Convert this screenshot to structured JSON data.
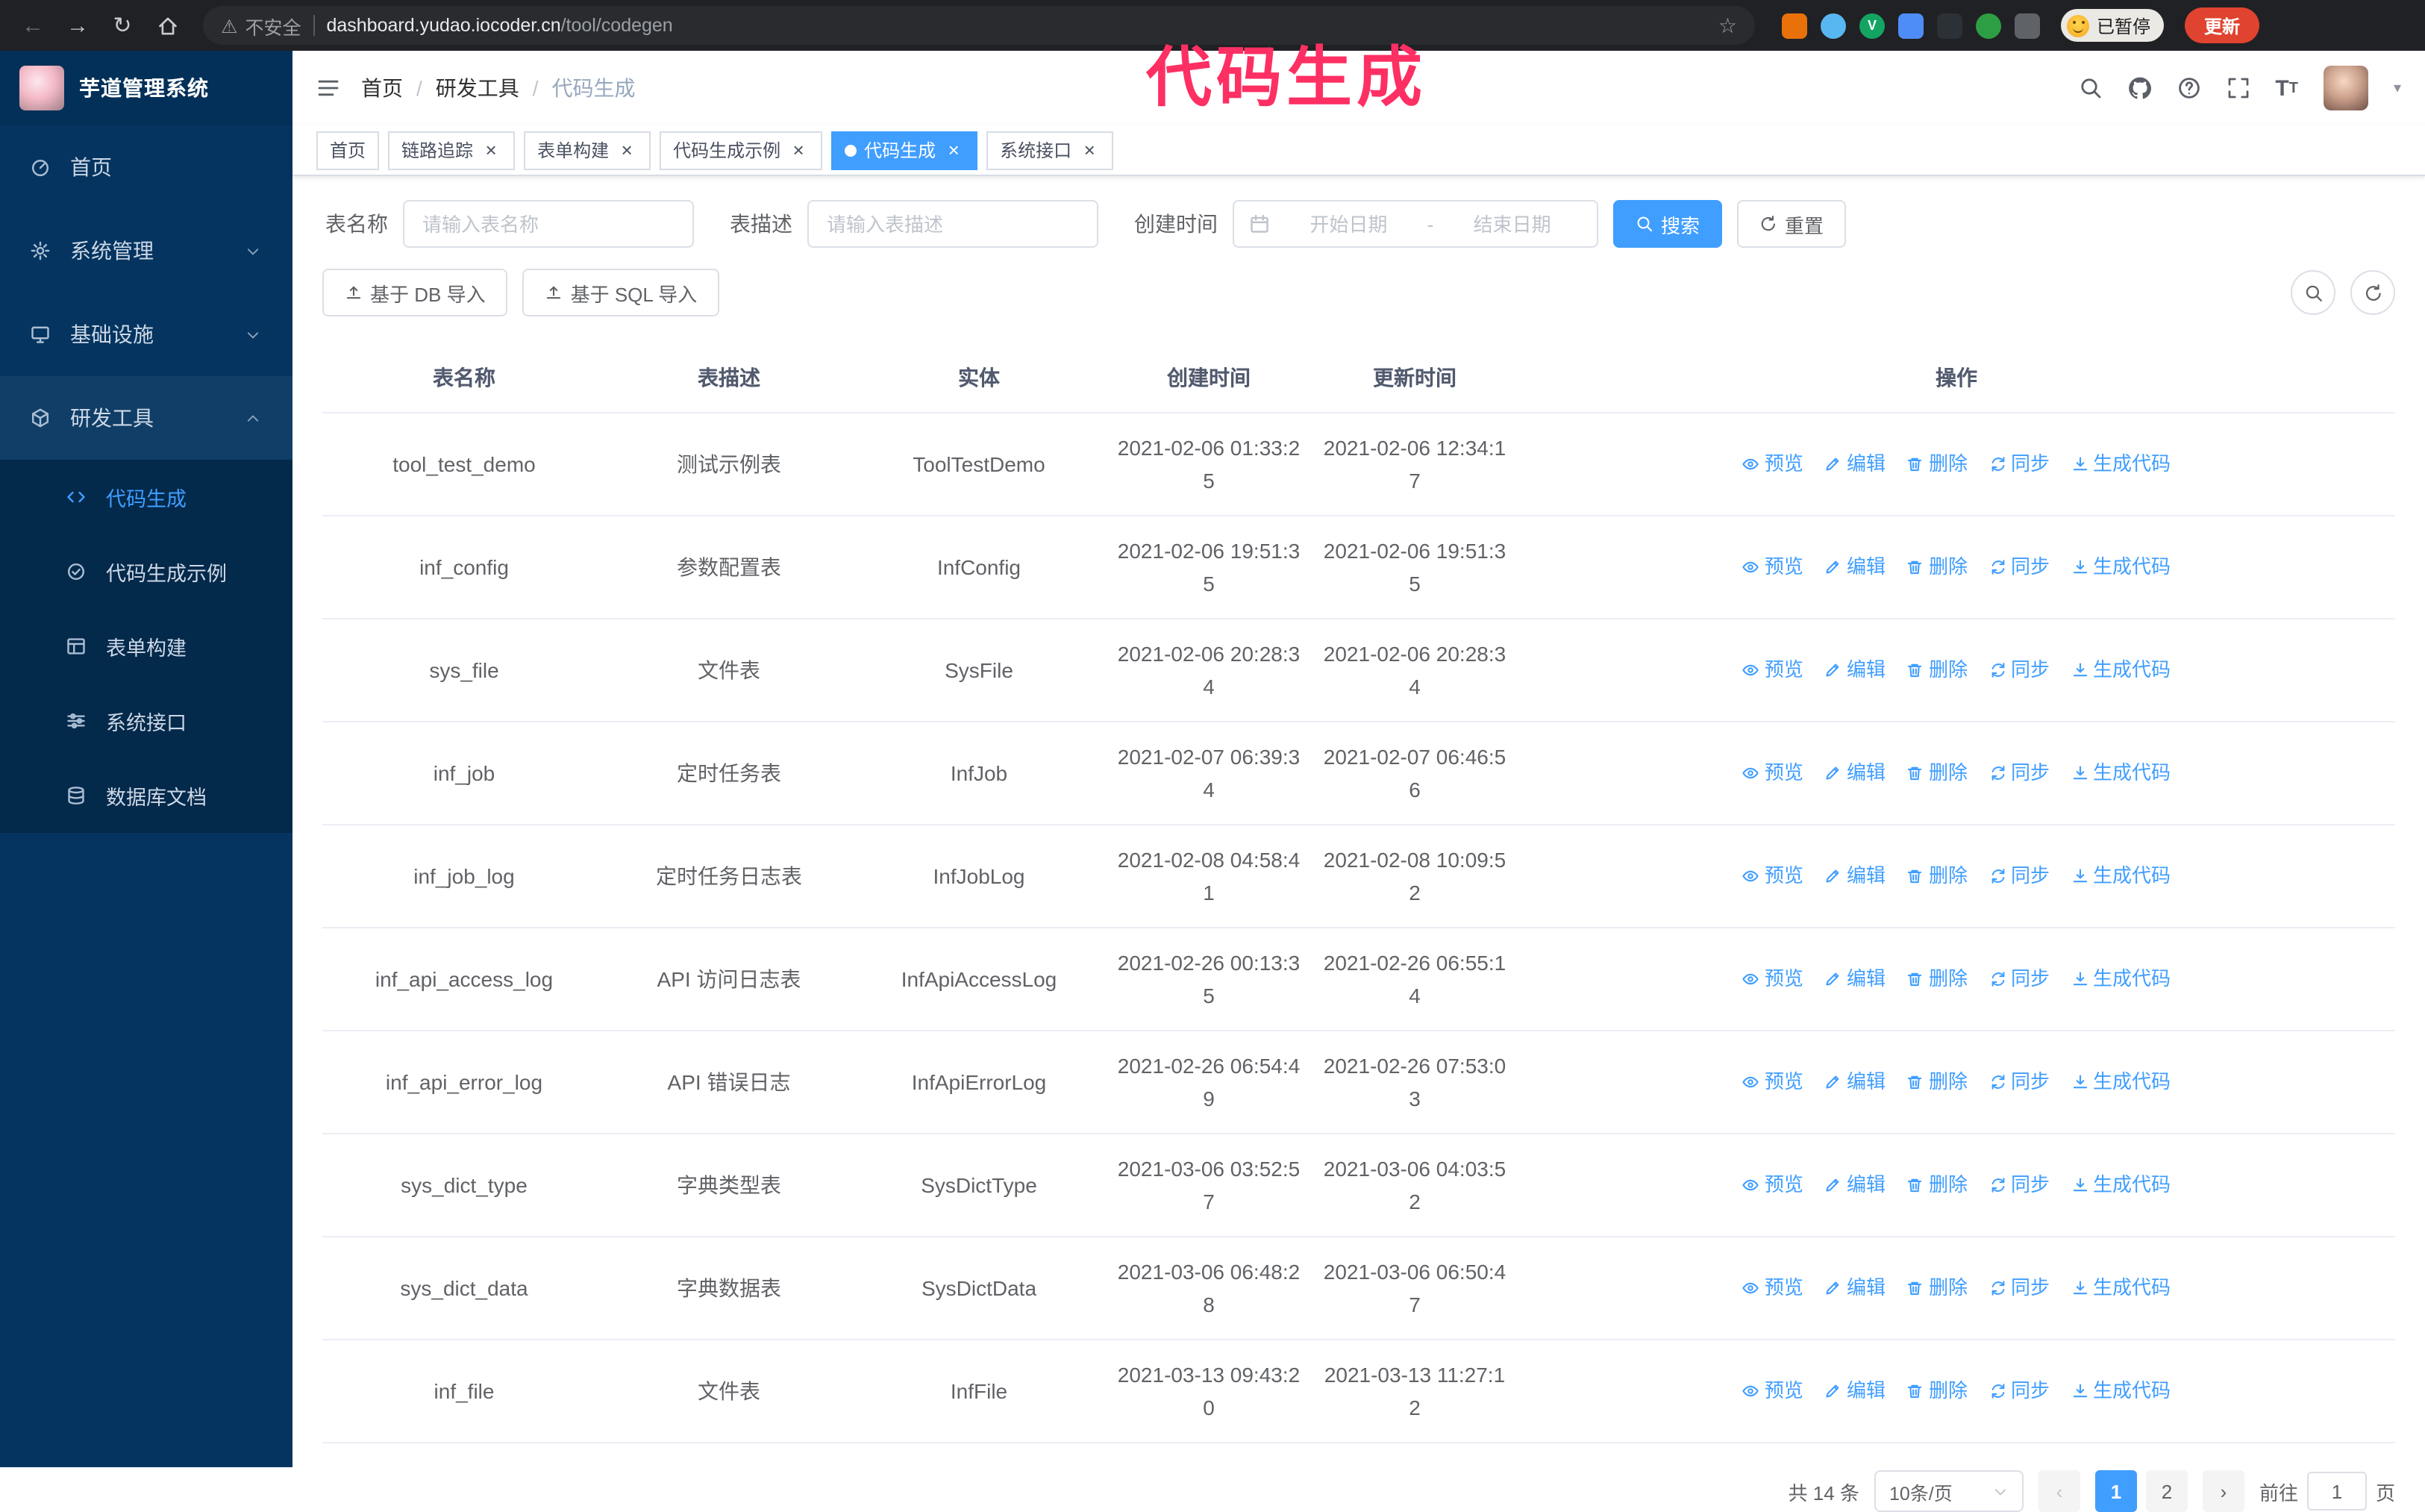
{
  "browser": {
    "warning": "不安全",
    "url_host": "dashboard.yudao.iocoder.cn",
    "url_path": "/tool/codegen",
    "paused_badge": "已暂停",
    "update_button": "更新"
  },
  "annotation": {
    "text": "代码生成"
  },
  "sidebar": {
    "title": "芋道管理系统",
    "menu": [
      {
        "key": "home",
        "label": "首页",
        "icon": "dashboard-icon",
        "type": "item"
      },
      {
        "key": "system",
        "label": "系统管理",
        "icon": "gear-icon",
        "type": "group",
        "state": "collapsed"
      },
      {
        "key": "infra",
        "label": "基础设施",
        "icon": "infra-icon",
        "type": "group",
        "state": "collapsed"
      },
      {
        "key": "dev-tools",
        "label": "研发工具",
        "icon": "tools-icon",
        "type": "group",
        "state": "expanded",
        "children": [
          {
            "key": "codegen",
            "label": "代码生成",
            "icon": "code-icon",
            "active": true
          },
          {
            "key": "codegen-example",
            "label": "代码生成示例",
            "icon": "example-icon",
            "active": false
          },
          {
            "key": "form-builder",
            "label": "表单构建",
            "icon": "form-icon",
            "active": false
          },
          {
            "key": "system-api",
            "label": "系统接口",
            "icon": "api-icon",
            "active": false
          },
          {
            "key": "db-doc",
            "label": "数据库文档",
            "icon": "db-icon",
            "active": false
          }
        ]
      }
    ]
  },
  "navbar": {
    "breadcrumb": [
      "首页",
      "研发工具",
      "代码生成"
    ]
  },
  "tabs": [
    {
      "key": "home",
      "label": "首页",
      "closable": false,
      "active": false
    },
    {
      "key": "tracing",
      "label": "链路追踪",
      "closable": true,
      "active": false
    },
    {
      "key": "form-builder",
      "label": "表单构建",
      "closable": true,
      "active": false
    },
    {
      "key": "codegen-example",
      "label": "代码生成示例",
      "closable": true,
      "active": false
    },
    {
      "key": "codegen",
      "label": "代码生成",
      "closable": true,
      "active": true
    },
    {
      "key": "system-api",
      "label": "系统接口",
      "closable": true,
      "active": false
    }
  ],
  "filters": {
    "name_label": "表名称",
    "name_placeholder": "请输入表名称",
    "desc_label": "表描述",
    "desc_placeholder": "请输入表描述",
    "time_label": "创建时间",
    "start_placeholder": "开始日期",
    "range_separator": "-",
    "end_placeholder": "结束日期",
    "search_button": "搜索",
    "reset_button": "重置"
  },
  "toolbar": {
    "import_db": "基于 DB 导入",
    "import_sql": "基于 SQL 导入"
  },
  "table": {
    "columns": [
      "表名称",
      "表描述",
      "实体",
      "创建时间",
      "更新时间",
      "操作"
    ],
    "row_actions": [
      {
        "key": "preview",
        "label": "预览",
        "icon": "eye-icon"
      },
      {
        "key": "edit",
        "label": "编辑",
        "icon": "edit-icon"
      },
      {
        "key": "delete",
        "label": "删除",
        "icon": "delete-icon"
      },
      {
        "key": "sync",
        "label": "同步",
        "icon": "sync-icon"
      },
      {
        "key": "generate",
        "label": "生成代码",
        "icon": "download-icon"
      }
    ],
    "rows": [
      {
        "name": "tool_test_demo",
        "desc": "测试示例表",
        "entity": "ToolTestDemo",
        "created": "2021-02-06 01:33:25",
        "updated": "2021-02-06 12:34:17"
      },
      {
        "name": "inf_config",
        "desc": "参数配置表",
        "entity": "InfConfig",
        "created": "2021-02-06 19:51:35",
        "updated": "2021-02-06 19:51:35"
      },
      {
        "name": "sys_file",
        "desc": "文件表",
        "entity": "SysFile",
        "created": "2021-02-06 20:28:34",
        "updated": "2021-02-06 20:28:34"
      },
      {
        "name": "inf_job",
        "desc": "定时任务表",
        "entity": "InfJob",
        "created": "2021-02-07 06:39:34",
        "updated": "2021-02-07 06:46:56"
      },
      {
        "name": "inf_job_log",
        "desc": "定时任务日志表",
        "entity": "InfJobLog",
        "created": "2021-02-08 04:58:41",
        "updated": "2021-02-08 10:09:52"
      },
      {
        "name": "inf_api_access_log",
        "desc": "API 访问日志表",
        "entity": "InfApiAccessLog",
        "created": "2021-02-26 00:13:35",
        "updated": "2021-02-26 06:55:14"
      },
      {
        "name": "inf_api_error_log",
        "desc": "API 错误日志",
        "entity": "InfApiErrorLog",
        "created": "2021-02-26 06:54:49",
        "updated": "2021-02-26 07:53:03"
      },
      {
        "name": "sys_dict_type",
        "desc": "字典类型表",
        "entity": "SysDictType",
        "created": "2021-03-06 03:52:57",
        "updated": "2021-03-06 04:03:52"
      },
      {
        "name": "sys_dict_data",
        "desc": "字典数据表",
        "entity": "SysDictData",
        "created": "2021-03-06 06:48:28",
        "updated": "2021-03-06 06:50:47"
      },
      {
        "name": "inf_file",
        "desc": "文件表",
        "entity": "InfFile",
        "created": "2021-03-13 09:43:20",
        "updated": "2021-03-13 11:27:12"
      }
    ]
  },
  "pagination": {
    "total_text": "共 14 条",
    "page_size": "10条/页",
    "pages": [
      "1",
      "2"
    ],
    "active_page": "1",
    "goto_label": "前往",
    "goto_value": "1",
    "goto_suffix": "页"
  },
  "colors": {
    "accent": "#409eff",
    "annotation": "#fd2f63",
    "sidebar_bg": "#04345f",
    "submenu_bg": "#03294b"
  }
}
